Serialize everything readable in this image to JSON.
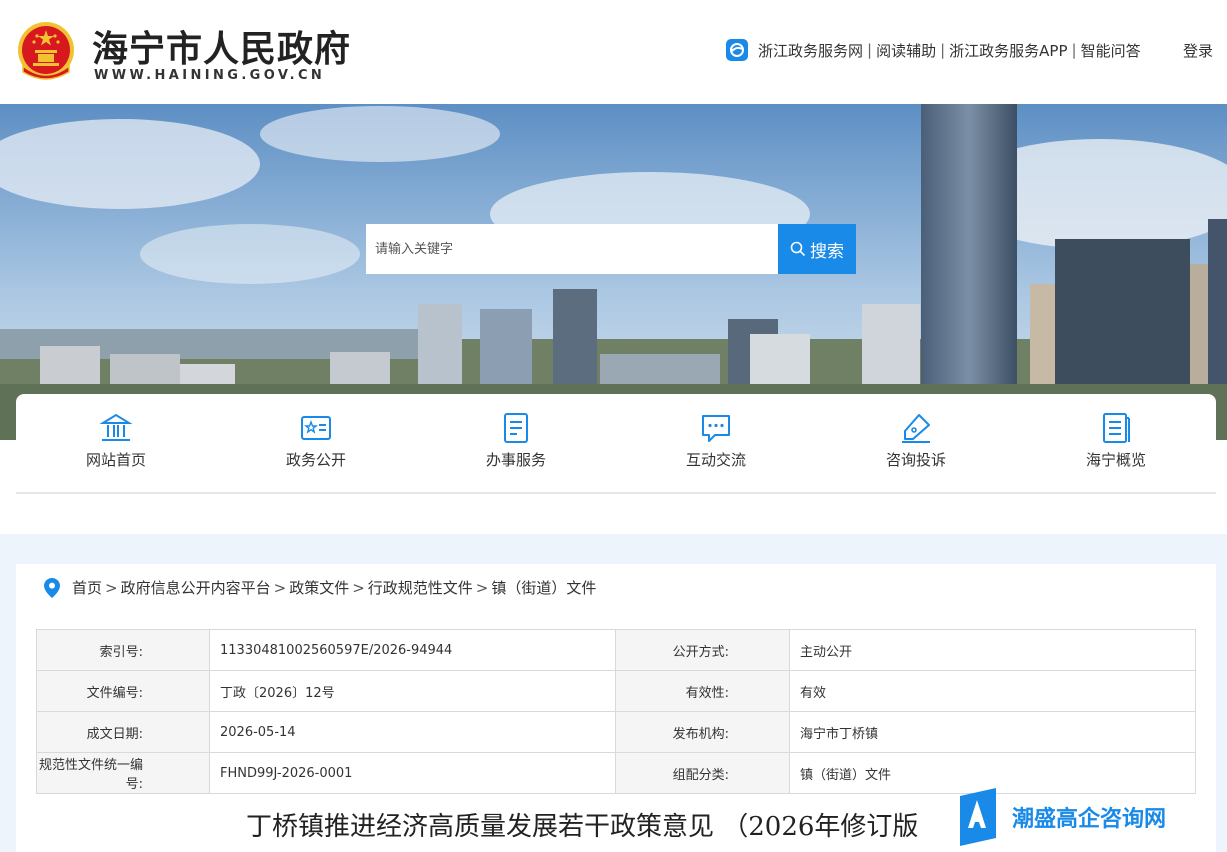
{
  "header": {
    "site_title": "海宁市人民政府",
    "site_domain": "WWW.HAINING.GOV.CN",
    "top_links": [
      "浙江政务服务网",
      "阅读辅助",
      "浙江政务服务APP",
      "智能问答"
    ],
    "separator": "|",
    "login": "登录"
  },
  "search": {
    "placeholder": "请输入关键字",
    "button_label": "搜索"
  },
  "nav": {
    "items": [
      {
        "label": "网站首页",
        "icon": "bank-icon"
      },
      {
        "label": "政务公开",
        "icon": "id-card-icon"
      },
      {
        "label": "办事服务",
        "icon": "document-icon"
      },
      {
        "label": "互动交流",
        "icon": "chat-icon"
      },
      {
        "label": "咨询投诉",
        "icon": "pen-icon"
      },
      {
        "label": "海宁概览",
        "icon": "book-icon"
      }
    ]
  },
  "breadcrumb": {
    "items": [
      "首页",
      "政府信息公开内容平台",
      "政策文件",
      "行政规范性文件",
      "镇（街道）文件"
    ],
    "separator": ">"
  },
  "meta": {
    "rows": [
      {
        "k1": "索引号:",
        "v1": "11330481002560597E/2026-94944",
        "k2": "公开方式:",
        "v2": "主动公开"
      },
      {
        "k1": "文件编号:",
        "v1": "丁政〔2026〕12号",
        "k2": "有效性:",
        "v2": "有效"
      },
      {
        "k1": "成文日期:",
        "v1": "2026-05-14",
        "k2": "发布机构:",
        "v2": "海宁市丁桥镇"
      },
      {
        "k1": "规范性文件统一编号:",
        "v1": "FHND99J-2026-0001",
        "k2": "组配分类:",
        "v2": "镇（街道）文件"
      }
    ]
  },
  "document": {
    "title": "丁桥镇推进经济高质量发展若干政策意见 （2026年修订版"
  },
  "watermark": {
    "text": "潮盛高企咨询网"
  },
  "colors": {
    "accent": "#1a8ae8",
    "emblem_red": "#d7181f",
    "emblem_gold": "#f2c232"
  }
}
